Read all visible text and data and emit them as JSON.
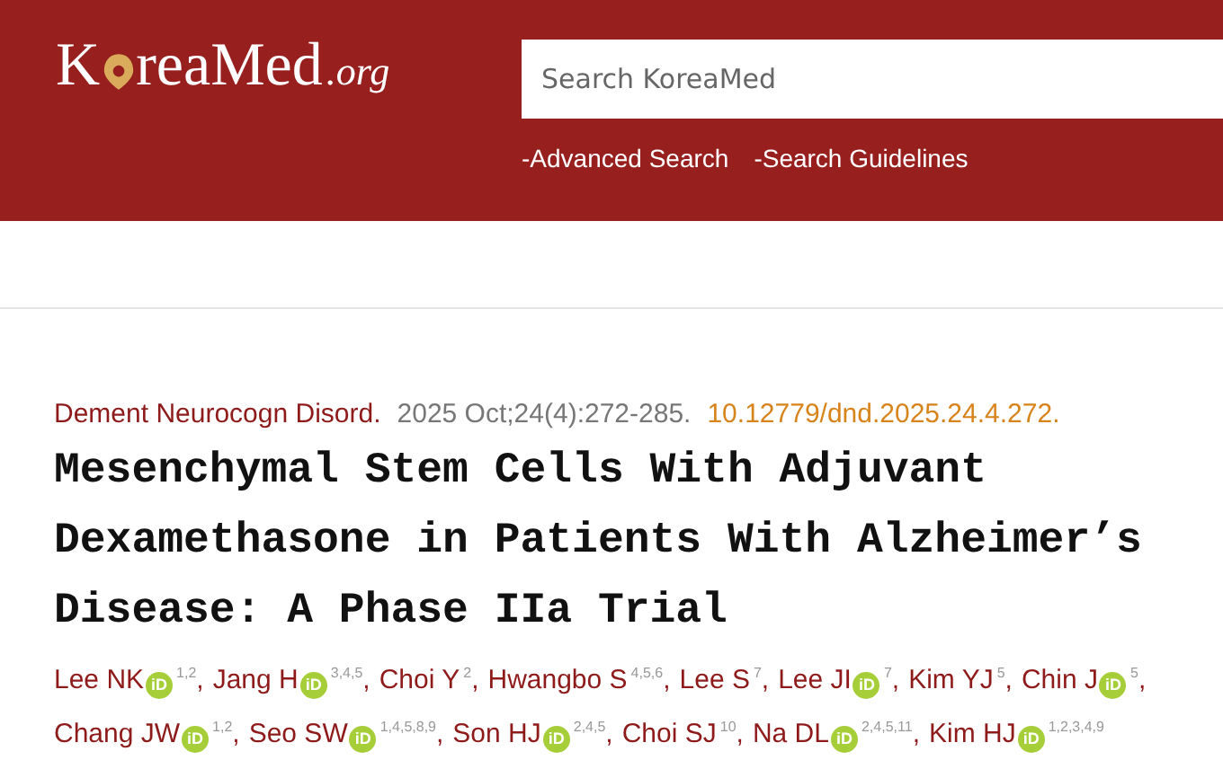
{
  "logo": {
    "first": "K",
    "rest": "reaMed",
    "suffix": ".org"
  },
  "search": {
    "placeholder": "Search KoreaMed"
  },
  "links": [
    "-Advanced Search",
    "-Search Guidelines"
  ],
  "citation": {
    "journal": "Dement Neurocogn Disord.",
    "details": "2025 Oct;24(4):272-285.",
    "doi": "10.12779/dnd.2025.24.4.272."
  },
  "title": "Mesenchymal Stem Cells With Adjuvant Dexamethasone in Patients With Alzheimer’s Disease: A Phase IIa Trial",
  "authors": [
    {
      "name": "Lee NK",
      "badge": "iD",
      "affiliations": "1,2",
      "separator": ","
    },
    {
      "name": "Jang H",
      "badge": "iD",
      "affiliations": "3,4,5",
      "separator": ","
    },
    {
      "name": "Choi Y",
      "affiliations": "2",
      "separator": ","
    },
    {
      "name": "Hwangbo S",
      "affiliations": "4,5,6",
      "separator": ","
    },
    {
      "name": "Lee S",
      "affiliations": "7",
      "separator": ","
    },
    {
      "name": "Lee JI",
      "badge": "iD",
      "affiliations": "7",
      "separator": ","
    },
    {
      "name": "Kim YJ",
      "affiliations": "5",
      "separator": ","
    },
    {
      "name": "Chin J",
      "badge": "iD",
      "affiliations": "5",
      "separator": ","
    },
    {
      "name": "Chang JW",
      "badge": "iD",
      "affiliations": "1,2",
      "separator": ","
    },
    {
      "name": "Seo SW",
      "badge": "iD",
      "affiliations": "1,4,5,8,9",
      "separator": ","
    },
    {
      "name": "Son HJ",
      "badge": "iD",
      "affiliations": "2,4,5",
      "separator": ","
    },
    {
      "name": "Choi SJ",
      "affiliations": "10",
      "separator": ","
    },
    {
      "name": "Na DL",
      "badge": "iD",
      "affiliations": "2,4,5,11",
      "separator": ","
    },
    {
      "name": "Kim HJ",
      "badge": "iD",
      "affiliations": "1,2,3,4,9"
    }
  ]
}
